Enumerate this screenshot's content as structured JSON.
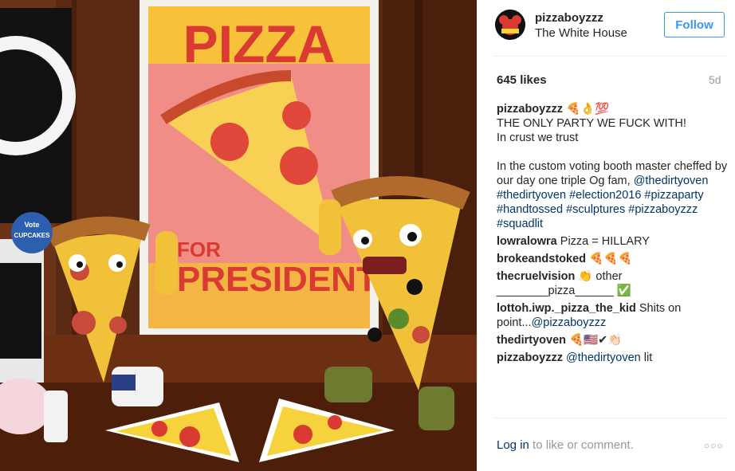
{
  "post": {
    "username": "pizzaboyzzz",
    "location": "The White House",
    "follow_label": "Follow",
    "likes": "645 likes",
    "age": "5d"
  },
  "photo": {
    "poster_title": "PIZZA",
    "poster_for": "FOR",
    "poster_president": "PRESIDENT",
    "button_text_1": "Vote",
    "button_text_2": "CUPCAKES"
  },
  "caption": {
    "username": "pizzaboyzzz",
    "emoji": "🍕👌💯",
    "line1": "THE ONLY PARTY WE FUCK WITH!",
    "line2": "In crust we trust",
    "line3": "In the custom voting booth master cheffed by our day one triple Og fam,",
    "mention": "@thedirtyoven",
    "hashtags": "#thedirtyoven #election2016 #pizzaparty #handtossed #sculptures #pizzaboyzzz #squadlit"
  },
  "comments": [
    {
      "user": "lowralowra",
      "text": "Pizza = HILLARY"
    },
    {
      "user": "brokeandstoked",
      "text": "🍕🍕🍕"
    },
    {
      "user": "thecruelvision",
      "text": "👏 other ________pizza______ ✅"
    },
    {
      "user": "lottoh.iwp._pizza_the_kid",
      "text": "Shits on point...",
      "mention": "@pizzaboyzzz"
    },
    {
      "user": "thedirtyoven",
      "text": "🍕🇺🇸✔👏🏻"
    },
    {
      "user": "pizzaboyzzz",
      "text": "lit",
      "mention": "@thedirtyoven"
    }
  ],
  "footer": {
    "login_link": "Log in",
    "login_rest": " to like or comment.",
    "more_icon": "more-options-icon"
  },
  "colors": {
    "accent": "#3897f0",
    "link": "#003569",
    "muted": "#999999",
    "text": "#262626"
  }
}
